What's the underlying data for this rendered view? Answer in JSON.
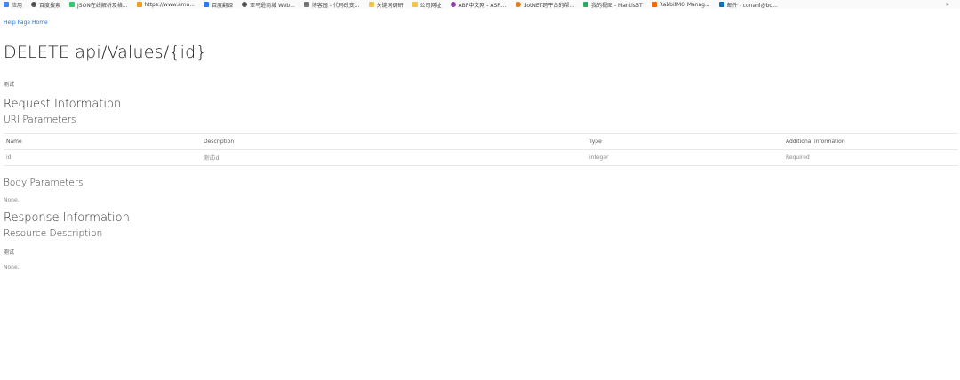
{
  "bookmarks": {
    "items": [
      {
        "icon": "apps-grid-icon",
        "label": "应用",
        "color": "#4285f4"
      },
      {
        "icon": "globe-icon",
        "label": "百度搜索",
        "color": "#555555"
      },
      {
        "icon": "bookmark-icon",
        "label": "JSON在线解析及格...",
        "color": "#2ecc71"
      },
      {
        "icon": "amazon-icon",
        "label": "https://www.ama...",
        "color": "#f39c12"
      },
      {
        "icon": "translate-icon",
        "label": "百度翻译",
        "color": "#2979ff"
      },
      {
        "icon": "globe-icon",
        "label": "亚马逊商城 Web...",
        "color": "#555555"
      },
      {
        "icon": "blog-icon",
        "label": "博客园 - 代码改变...",
        "color": "#777777"
      },
      {
        "icon": "folder-icon",
        "label": "关键词调研",
        "color": "#f4c542"
      },
      {
        "icon": "folder-icon",
        "label": "公司网址",
        "color": "#f4c542"
      },
      {
        "icon": "abp-icon",
        "label": "ABP中文网 - ASP....",
        "color": "#8e44ad"
      },
      {
        "icon": "dotnet-icon",
        "label": "dotNET跨平台的帮...",
        "color": "#e67e22"
      },
      {
        "icon": "mantis-icon",
        "label": "我的视图 - MantisBT",
        "color": "#27ae60"
      },
      {
        "icon": "rabbitmq-icon",
        "label": "RabbitMQ Manag...",
        "color": "#ff6600"
      },
      {
        "icon": "mail-icon",
        "label": "邮件 - conanl@bq...",
        "color": "#0072c6"
      }
    ],
    "more": "»"
  },
  "nav": {
    "home_link": "Help Page Home"
  },
  "page": {
    "title": "DELETE api/Values/{id}",
    "description": "测试",
    "request_heading": "Request Information",
    "uri_heading": "URI Parameters",
    "body_heading": "Body Parameters",
    "body_none": "None.",
    "response_heading": "Response Information",
    "resource_heading": "Resource Description",
    "resource_desc": "测试",
    "resource_none": "None."
  },
  "uri_table": {
    "headers": [
      "Name",
      "Description",
      "Type",
      "Additional information"
    ],
    "rows": [
      [
        "id",
        "测试id",
        "integer",
        "Required"
      ]
    ]
  }
}
